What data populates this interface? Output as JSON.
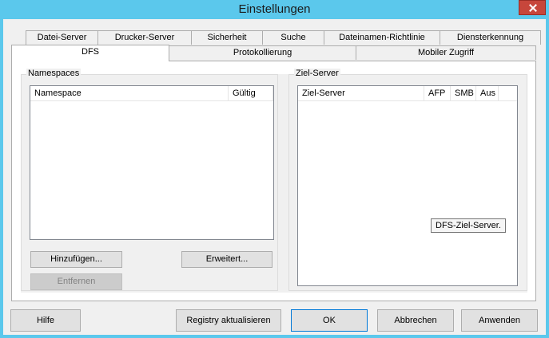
{
  "window": {
    "title": "Einstellungen"
  },
  "tabs": {
    "row1": [
      "Datei-Server",
      "Drucker-Server",
      "Sicherheit",
      "Suche",
      "Dateinamen-Richtlinie",
      "Diensterkennung"
    ],
    "row2": [
      "DFS",
      "Protokollierung",
      "Mobiler Zugriff"
    ],
    "active": "DFS"
  },
  "namespaces": {
    "group_title": "Namespaces",
    "columns": [
      "Namespace",
      "Gültig"
    ],
    "add_label": "Hinzufügen...",
    "advanced_label": "Erweitert...",
    "remove_label": "Entfernen"
  },
  "targets": {
    "group_title": "Ziel-Server",
    "columns": [
      "Ziel-Server",
      "AFP",
      "SMB",
      "Aus"
    ],
    "tooltip": "DFS-Ziel-Server."
  },
  "footer": {
    "help": "Hilfe",
    "update_registry": "Registry aktualisieren",
    "ok": "OK",
    "cancel": "Abbrechen",
    "apply": "Anwenden"
  }
}
